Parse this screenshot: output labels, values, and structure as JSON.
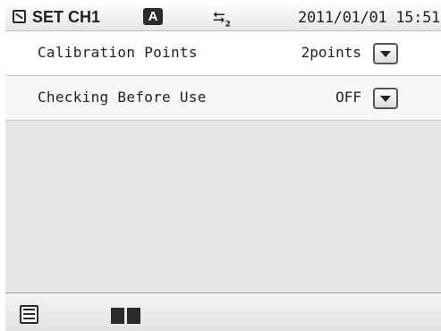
{
  "statusbar": {
    "mode_icon": "measure-mode-icon",
    "title": "SET CH1",
    "badge": "A",
    "usb_icon": "usb-icon",
    "usb_index": "2",
    "datetime": "2011/01/01 15:51"
  },
  "settings": [
    {
      "label": "Calibration Points",
      "value": "2points"
    },
    {
      "label": "Checking Before Use",
      "value": "OFF"
    }
  ],
  "toolbar": {
    "list_icon": "list-icon",
    "manual_icon": "book-icon"
  },
  "colors": {
    "text": "#222222",
    "empty_area": "#e6e6e6",
    "divider": "#c8c8c8"
  }
}
